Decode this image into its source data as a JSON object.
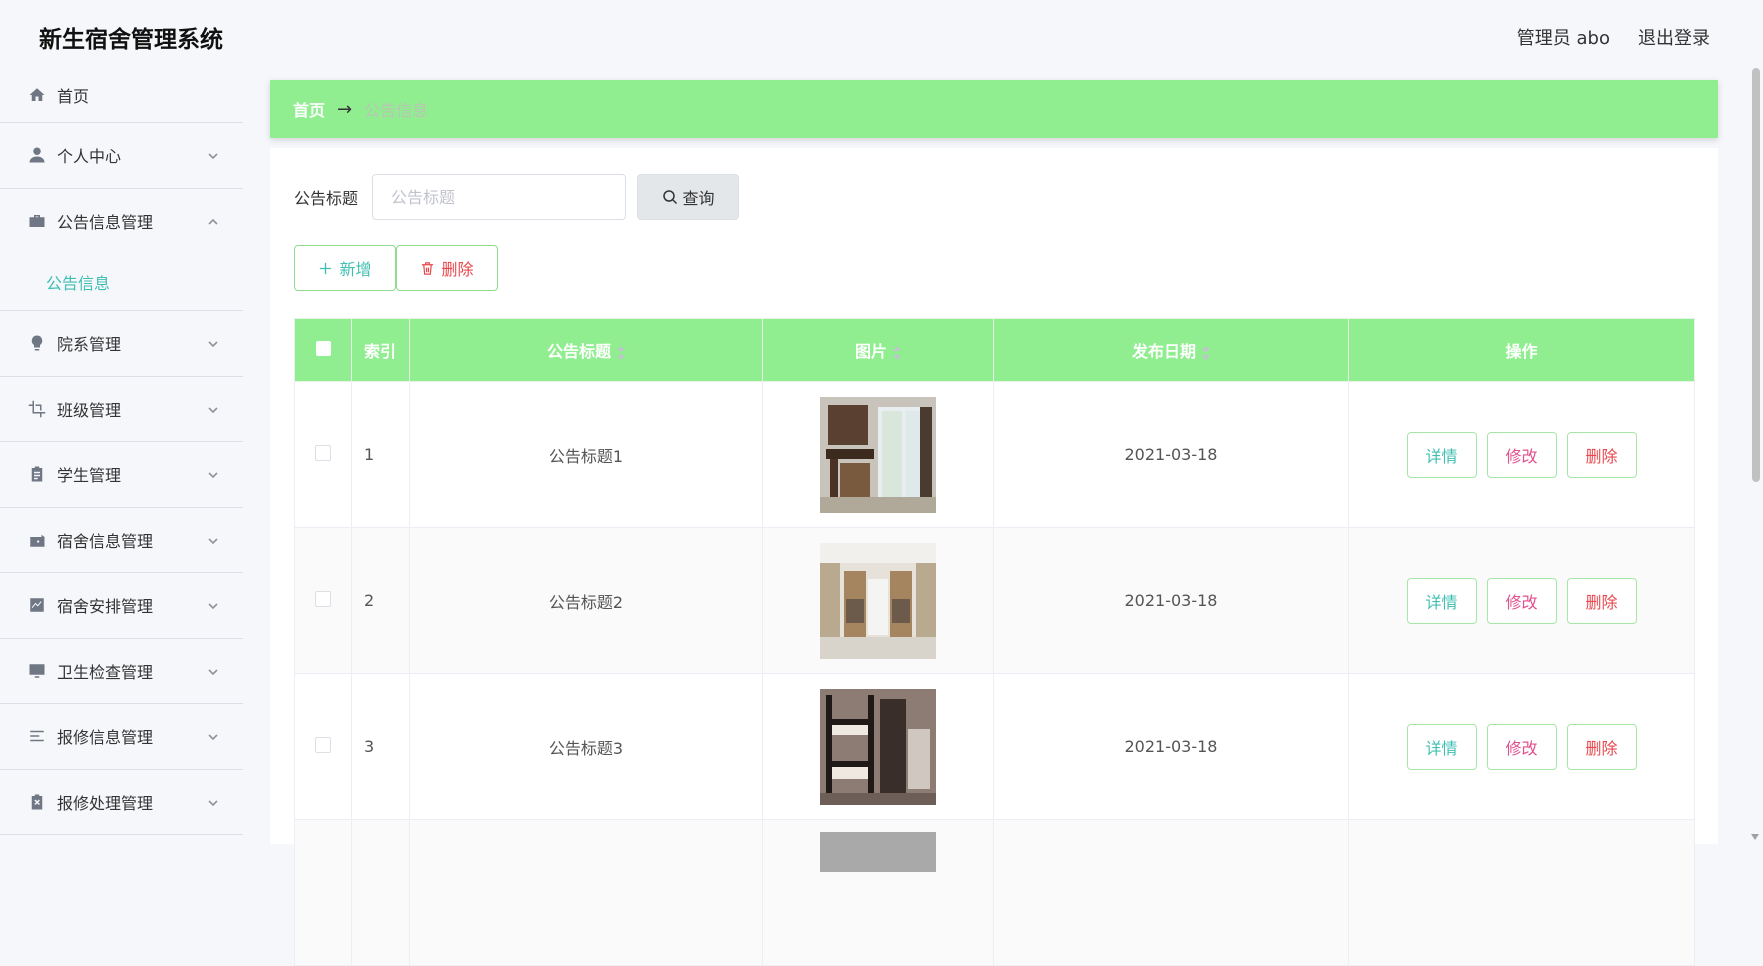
{
  "header": {
    "title": "新生宿舍管理系统",
    "user_label": "管理员 abo",
    "logout_label": "退出登录"
  },
  "sidebar": {
    "items": [
      {
        "label": "首页",
        "icon": "home-icon"
      },
      {
        "label": "个人中心",
        "icon": "user-icon"
      },
      {
        "label": "公告信息管理",
        "icon": "briefcase-icon",
        "expanded": true,
        "children": [
          {
            "label": "公告信息",
            "active": true
          }
        ]
      },
      {
        "label": "院系管理",
        "icon": "bulb-icon"
      },
      {
        "label": "班级管理",
        "icon": "crop-icon"
      },
      {
        "label": "学生管理",
        "icon": "clipboard-icon"
      },
      {
        "label": "宿舍信息管理",
        "icon": "wallet-icon"
      },
      {
        "label": "宿舍安排管理",
        "icon": "chart-icon"
      },
      {
        "label": "卫生检查管理",
        "icon": "monitor-icon"
      },
      {
        "label": "报修信息管理",
        "icon": "list-icon"
      },
      {
        "label": "报修处理管理",
        "icon": "cancel-doc-icon"
      }
    ]
  },
  "breadcrumb": {
    "home": "首页",
    "arrow": "→",
    "current": "公告信息"
  },
  "search": {
    "label": "公告标题",
    "placeholder": "公告标题",
    "value": "",
    "button_label": "查询"
  },
  "actions": {
    "add_label": "新增",
    "delete_label": "删除"
  },
  "table": {
    "columns": [
      "",
      "索引",
      "公告标题",
      "图片",
      "发布日期",
      "操作"
    ],
    "rows": [
      {
        "index": "1",
        "title": "公告标题1",
        "date": "2021-03-18"
      },
      {
        "index": "2",
        "title": "公告标题2",
        "date": "2021-03-18"
      },
      {
        "index": "3",
        "title": "公告标题3",
        "date": "2021-03-18"
      }
    ],
    "row_actions": {
      "detail": "详情",
      "edit": "修改",
      "delete": "删除"
    }
  },
  "colors": {
    "accent_green": "#90ee90",
    "teal": "#3fbfb2",
    "pink": "#e0508d",
    "red": "#e8474c"
  }
}
